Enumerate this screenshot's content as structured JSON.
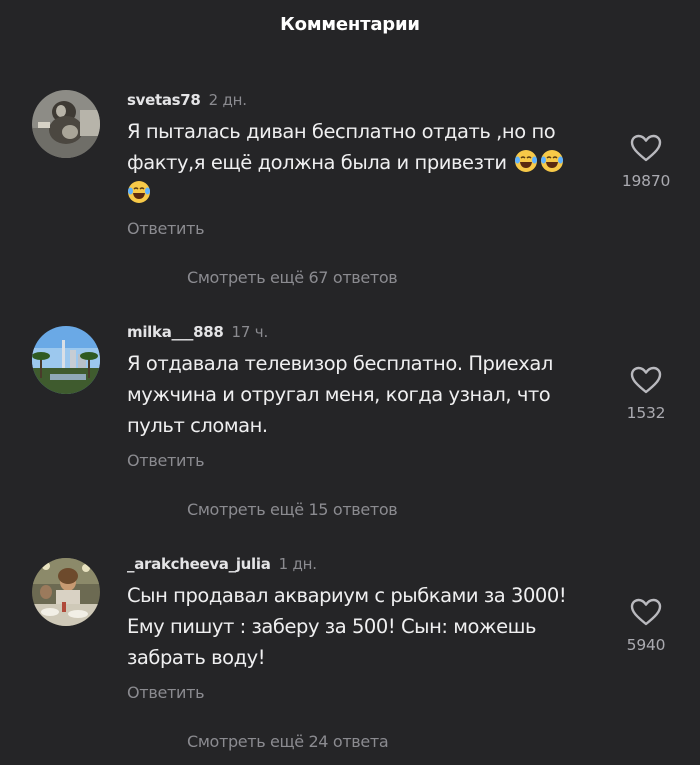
{
  "header": {
    "title": "Комментарии"
  },
  "comments": [
    {
      "username": "svetas78",
      "time": "2 дн.",
      "text": "Я пыталась диван бесплатно отдать ,но по факту,я ещё должна была и привезти",
      "emoji": [
        "laughing-tears-emoji",
        "laughing-tears-emoji",
        "laughing-tears-emoji"
      ],
      "reply": "Ответить",
      "likes": "19870",
      "view_more": "Смотреть ещё 67 ответов",
      "avatar_icon": "cat-photo-avatar"
    },
    {
      "username": "milka___888",
      "time": "17 ч.",
      "text": "Я отдавала телевизор бесплатно. Приехал мужчина и отругал меня, когда  узнал, что пульт сломан.",
      "reply": "Ответить",
      "likes": "1532",
      "view_more": "Смотреть ещё 15 ответов",
      "avatar_icon": "city-palms-photo-avatar"
    },
    {
      "username": "_arakcheeva_julia",
      "time": "1 дн.",
      "text": "Сын продавал аквариум с рыбками за 3000! Ему пишут : заберу за 500! Сын: можешь забрать воду!",
      "reply": "Ответить",
      "likes": "5940",
      "view_more": "Смотреть ещё 24 ответа",
      "avatar_icon": "restaurant-people-photo-avatar"
    }
  ],
  "icons": {
    "like": "heart-outline-icon"
  },
  "colors": {
    "background": "#252527",
    "primary_text": "#efeff0",
    "secondary_text": "#8b8b90"
  }
}
